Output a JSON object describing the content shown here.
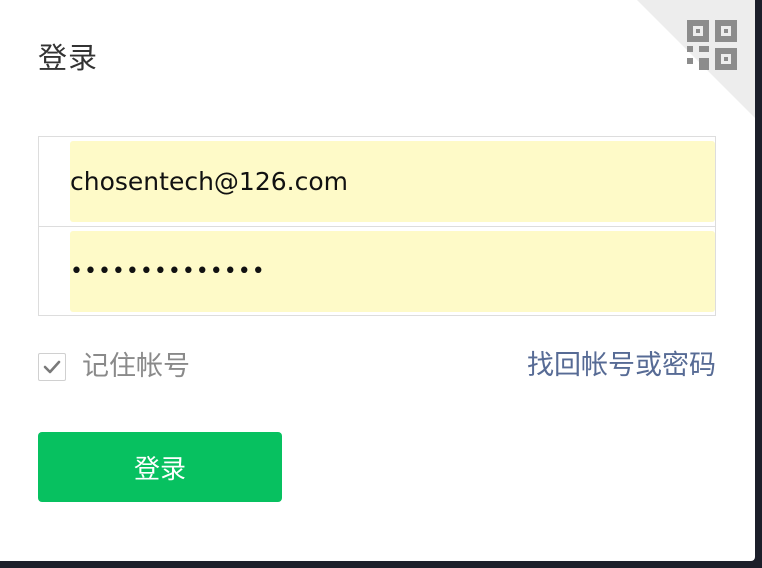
{
  "dialog": {
    "title": "登录",
    "qr_icon": "qrcode-icon"
  },
  "form": {
    "account_value": "chosentech@126.com",
    "password_value": "••••••••••••••"
  },
  "remember": {
    "label": "记住帐号",
    "checked": true,
    "icon": "checkmark-icon"
  },
  "recover_link": "找回帐号或密码",
  "login_button": "登录",
  "colors": {
    "primary_green": "#07c160",
    "link_blue": "#576b95",
    "autofill_yellow": "#fefac8"
  }
}
